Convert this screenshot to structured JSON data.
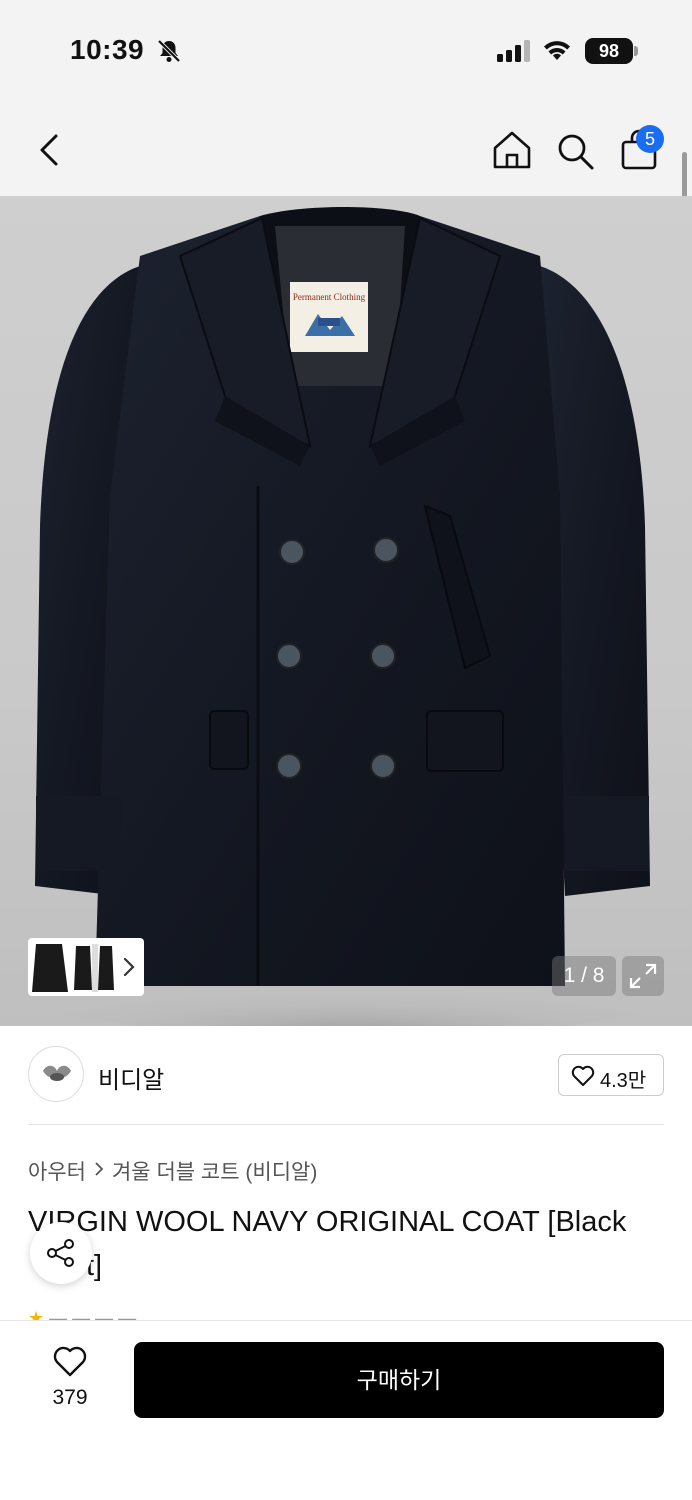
{
  "status_bar": {
    "time": "10:39",
    "battery": "98",
    "icons": [
      "bell-slash-icon",
      "cellular-signal-icon",
      "wifi-icon",
      "battery-icon"
    ]
  },
  "nav": {
    "icons": [
      "back-chevron-icon",
      "home-icon",
      "search-icon",
      "shopping-bag-icon"
    ],
    "cart_count": "5",
    "badge_color": "#1a6cf0"
  },
  "gallery": {
    "page_indicator": "1 / 8",
    "thumbnails_icon": "chevron-right-icon",
    "expand_icon": "expand-arrows-icon"
  },
  "brand": {
    "name": "비디알",
    "likes": "4.3만"
  },
  "breadcrumb": {
    "items": [
      "아우터",
      "겨울 더블 코트 (비디알)"
    ]
  },
  "product": {
    "title": "VIRGIN WOOL NAVY ORIGINAL COAT [Black Navy]",
    "title_visible_line1": "VIRGIN WOOL NAVY ORIGINAL COAT [Black",
    "title_visible_line2": "t]"
  },
  "bottom_bar": {
    "wish_count": "379",
    "buy_label": "구매하기",
    "buy_color": "#000000"
  }
}
